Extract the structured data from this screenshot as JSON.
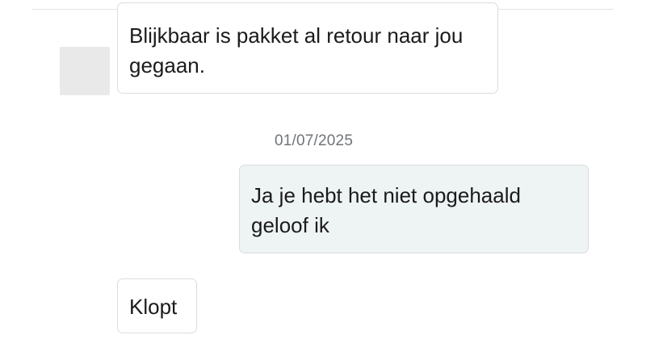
{
  "conversation": {
    "messages": [
      {
        "direction": "incoming",
        "text": "Blijkbaar is pakket al retour naar jou gegaan."
      },
      {
        "direction": "outgoing",
        "text": "Ja je hebt het niet opgehaald geloof ik"
      },
      {
        "direction": "incoming",
        "text": "Klopt"
      }
    ],
    "date_separator": "01/07/2025"
  },
  "colors": {
    "incoming_bubble_bg": "#ffffff",
    "outgoing_bubble_bg": "#eef3f4",
    "bubble_border": "#d9dde1",
    "date_text": "#6f7478"
  }
}
